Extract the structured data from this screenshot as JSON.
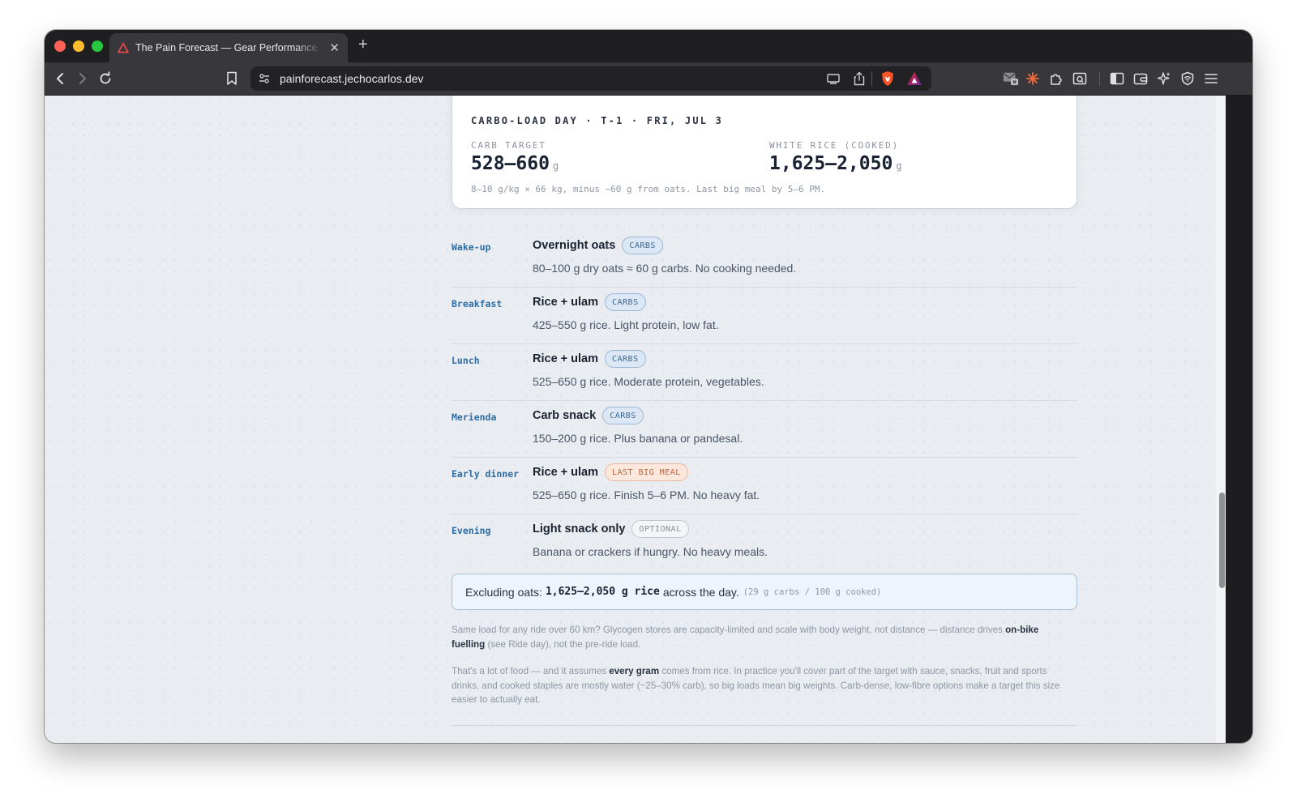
{
  "browser": {
    "tab_title": "The Pain Forecast — Gear Performance",
    "url": "painforecast.jechocarlos.dev"
  },
  "card": {
    "heading": "CARBO-LOAD DAY · T-1 · FRI, JUL 3",
    "stats": [
      {
        "label": "CARB TARGET",
        "value": "528–660",
        "unit": "g"
      },
      {
        "label": "WHITE RICE (COOKED)",
        "value": "1,625–2,050",
        "unit": "g"
      }
    ],
    "note": "8–10 g/kg × 66 kg, minus ~60 g from oats. Last big meal by 5–6 PM."
  },
  "meals": [
    {
      "time": "Wake-up",
      "name": "Overnight oats",
      "tag": "CARBS",
      "tag_type": "carbs",
      "desc": "80–100 g dry oats ≈ 60 g carbs. No cooking needed."
    },
    {
      "time": "Breakfast",
      "name": "Rice + ulam",
      "tag": "CARBS",
      "tag_type": "carbs",
      "desc": "425–550 g rice. Light protein, low fat."
    },
    {
      "time": "Lunch",
      "name": "Rice + ulam",
      "tag": "CARBS",
      "tag_type": "carbs",
      "desc": "525–650 g rice. Moderate protein, vegetables."
    },
    {
      "time": "Merienda",
      "name": "Carb snack",
      "tag": "CARBS",
      "tag_type": "carbs",
      "desc": "150–200 g rice. Plus banana or pandesal."
    },
    {
      "time": "Early dinner",
      "name": "Rice + ulam",
      "tag": "LAST BIG MEAL",
      "tag_type": "last",
      "desc": "525–650 g rice. Finish 5–6 PM. No heavy fat."
    },
    {
      "time": "Evening",
      "name": "Light snack only",
      "tag": "OPTIONAL",
      "tag_type": "opt",
      "desc": "Banana or crackers if hungry. No heavy meals."
    }
  ],
  "summary": {
    "prefix": "Excluding oats:",
    "strong": "1,625–2,050 g rice",
    "suffix": "across the day.",
    "note": "(29 g carbs / 100 g cooked)"
  },
  "paragraphs": {
    "p1_a": "Same load for any ride over 60 km? Glycogen stores are capacity-limited and scale with body weight, not distance — distance drives ",
    "p1_b": "on-bike fuelling",
    "p1_c": " (see Ride day), not the pre-ride load.",
    "p2_a": "That's a lot of food — and it assumes ",
    "p2_b": "every gram",
    "p2_c": " comes from rice. In practice you'll cover part of the target with sauce, snacks, fruit and sports drinks, and cooked staples are mostly water (~25–30% carb), so big loads mean big weights. Carb-dense, low-fibre options make a target this size easier to actually eat."
  },
  "colors": {
    "accent": "#2e6da4",
    "tag_carbs": "#3d668f",
    "tag_last": "#b9673e",
    "brave_orange": "#fb542b"
  }
}
